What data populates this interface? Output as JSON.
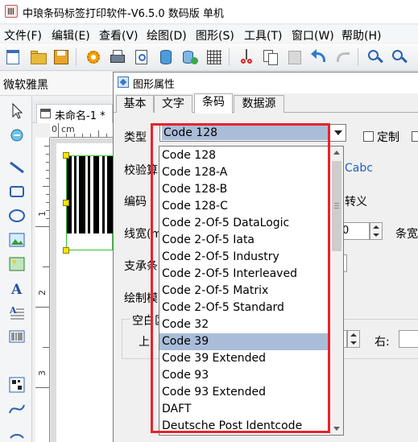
{
  "window": {
    "title": "中琅条码标签打印软件-V6.5.0 数码版 单机"
  },
  "menu": [
    {
      "label": "文件(F)"
    },
    {
      "label": "编辑(E)"
    },
    {
      "label": "查看(V)"
    },
    {
      "label": "绘图(D)"
    },
    {
      "label": "图形(S)"
    },
    {
      "label": "工具(T)"
    },
    {
      "label": "窗口(W)"
    },
    {
      "label": "帮助(H)"
    }
  ],
  "toolbar": {
    "icons": [
      "new-icon",
      "open-icon",
      "save-icon",
      "settings-icon",
      "print-icon",
      "print-preview-icon",
      "database-icon",
      "data-sources-icon",
      "grid-icon",
      "cut-icon",
      "copy-icon",
      "paste-icon",
      "undo-icon",
      "redo-icon",
      "zoom-in-icon",
      "zoom-out-icon"
    ]
  },
  "font_selector": {
    "value": "微软雅黑"
  },
  "document": {
    "tab_label": "未命名-1 *",
    "ruler_unit": "cm",
    "ruler_top_label": "0",
    "ruler_left_labels": [
      "1",
      "2",
      "3"
    ]
  },
  "dialog": {
    "title": "图形属性",
    "tabs": [
      {
        "label": "基本",
        "active": false
      },
      {
        "label": "文字",
        "active": false
      },
      {
        "label": "条码",
        "active": true
      },
      {
        "label": "数据源",
        "active": false
      }
    ],
    "type_label": "类型",
    "type_value": "Code 128",
    "custom_label": "定制",
    "checksum_label": "校验算",
    "checksum_value": "Cabc",
    "encoding_label": "编码",
    "escape_label": "转义",
    "line_width_label": "线宽(m",
    "line_width_value": "0",
    "bar_ratio_label": "条宽",
    "support_label": "支承条",
    "draw_mode_label": "绘制模",
    "quiet_zone_label": "空白区",
    "top_label": "上",
    "right_label": "右:"
  },
  "dropdown": {
    "items": [
      "Code 128",
      "Code 128-A",
      "Code 128-B",
      "Code 128-C",
      "Code 2-Of-5 DataLogic",
      "Code 2-Of-5 Iata",
      "Code 2-Of-5 Industry",
      "Code 2-Of-5 Interleaved",
      "Code 2-Of-5 Matrix",
      "Code 2-Of-5 Standard",
      "Code 32",
      "Code 39",
      "Code 39 Extended",
      "Code 93",
      "Code 93 Extended",
      "DAFT",
      "Deutsche Post Identcode"
    ],
    "selected": "Code 39"
  },
  "colors": {
    "highlight_border": "#e8232a",
    "selection": "#a9bdd9",
    "barcode_frame": "#35c235",
    "handle": "#ffe400"
  }
}
